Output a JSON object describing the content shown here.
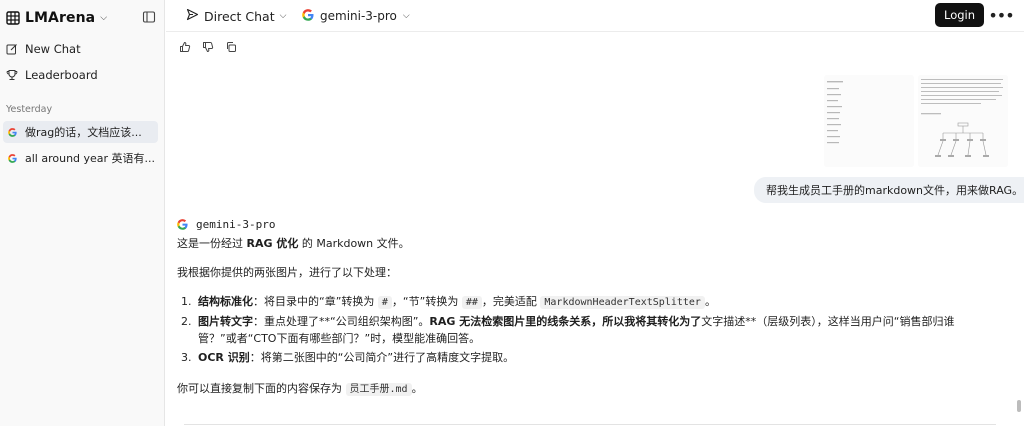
{
  "sidebar": {
    "brand": "LMArena",
    "nav": [
      {
        "label": "New Chat",
        "icon": "edit-icon"
      },
      {
        "label": "Leaderboard",
        "icon": "trophy-icon"
      }
    ],
    "section": "Yesterday",
    "history": [
      {
        "label": "做rag的话，文档应该...",
        "active": true
      },
      {
        "label": "all around year 英语有..."
      }
    ]
  },
  "topbar": {
    "mode": "Direct Chat",
    "model": "gemini-3-pro",
    "login": "Login"
  },
  "chat": {
    "user_message": "帮我生成员工手册的markdown文件，用来做RAG。",
    "response": {
      "model": "gemini-3-pro",
      "intro": [
        "这是一份经过 ",
        "RAG 优化",
        " 的 Markdown 文件。"
      ],
      "lead": "我根据你提供的两张图片，进行了以下处理：",
      "items": [
        {
          "num": "1.",
          "title": "结构标准化",
          "text_a": "：将目录中的“章”转换为 ",
          "code_a": "#",
          "text_b": "，“节”转换为 ",
          "code_b": "##",
          "text_c": "，完美适配 ",
          "code_c": "MarkdownHeaderTextSplitter",
          "text_d": "。"
        },
        {
          "num": "2.",
          "title": "图片转文字",
          "text_a": "：重点处理了**“公司组织架构图”。",
          "bold_b": "RAG 无法检索图片里的线条关系，所以我将其转化为了",
          "text_c": "文字描述**（层级列表），这样当用户问“销售部归谁管？”或者“CTO下面有哪些部门？”时，模型能准确回答。"
        },
        {
          "num": "3.",
          "title": "OCR 识别",
          "text_a": "：将第二张图中的“公司简介”进行了高精度文字提取。"
        }
      ],
      "outro_a": "你可以直接复制下面的内容保存为 ",
      "outro_code": "员工手册.md",
      "outro_b": "。"
    }
  }
}
